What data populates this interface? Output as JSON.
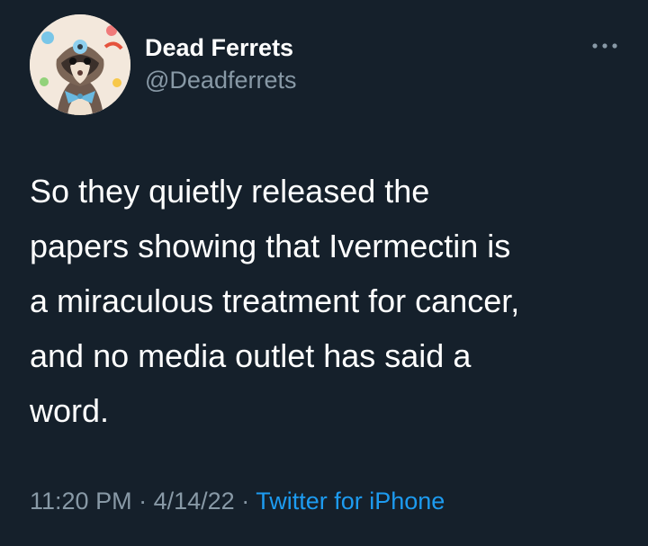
{
  "author": {
    "display_name": "Dead Ferrets",
    "handle": "@Deadferrets"
  },
  "tweet": {
    "text": "So they quietly released the\npapers showing that Ivermectin is\na miraculous treatment for cancer,\nand no media outlet has said a\nword.",
    "time": "11:20 PM",
    "separator": "·",
    "date": "4/14/22",
    "source": "Twitter for iPhone"
  },
  "icons": {
    "more": "more-options-icon",
    "avatar": "ferret-avatar"
  },
  "colors": {
    "background": "#15202b",
    "text": "#ffffff",
    "secondary": "#8899a6",
    "link": "#1d9bf0"
  }
}
